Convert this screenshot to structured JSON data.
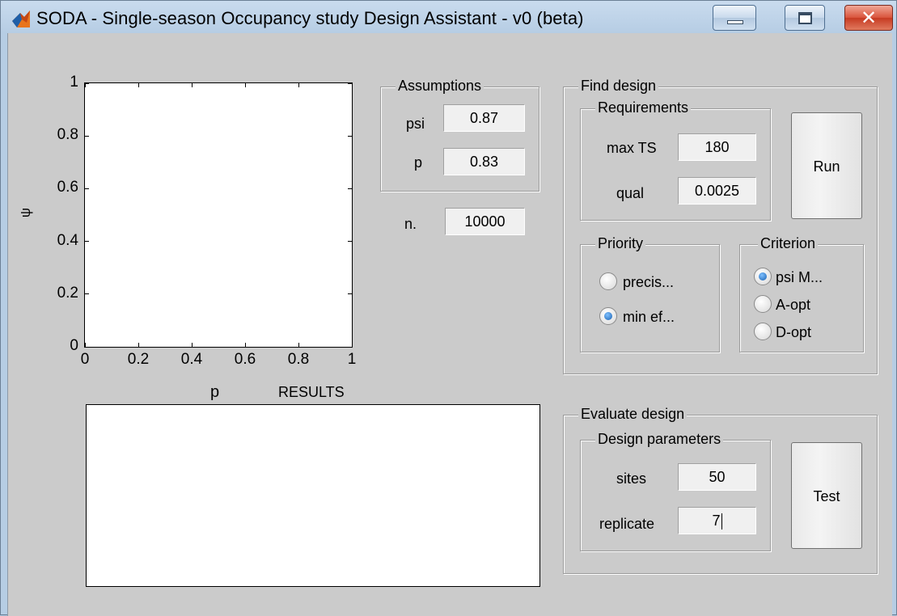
{
  "window": {
    "title": "SODA - Single-season Occupancy study Design Assistant - v0 (beta)",
    "controls": {
      "minimize": "minimize-icon",
      "maximize": "maximize-icon",
      "close": "close-icon"
    }
  },
  "chart_data": {
    "type": "scatter",
    "xlabel": "p",
    "ylabel": "ψ",
    "xlim": [
      0,
      1
    ],
    "ylim": [
      0,
      1
    ],
    "x_ticks": [
      "0",
      "0.2",
      "0.4",
      "0.6",
      "0.8",
      "1"
    ],
    "y_ticks": [
      "0",
      "0.2",
      "0.4",
      "0.6",
      "0.8",
      "1"
    ],
    "series": []
  },
  "results": {
    "label": "RESULTS",
    "text": ""
  },
  "assumptions": {
    "legend": "Assumptions",
    "psi_label": "psi",
    "psi_value": "0.87",
    "p_label": "p",
    "p_value": "0.83"
  },
  "n": {
    "label": "n.",
    "value": "10000"
  },
  "find_design": {
    "legend": "Find design",
    "requirements": {
      "legend": "Requirements",
      "maxts_label": "max TS",
      "maxts_value": "180",
      "qual_label": "qual",
      "qual_value": "0.0025"
    },
    "run_label": "Run",
    "priority": {
      "legend": "Priority",
      "options": [
        {
          "label": "precis...",
          "selected": false
        },
        {
          "label": "min ef...",
          "selected": true
        }
      ]
    },
    "criterion": {
      "legend": "Criterion",
      "options": [
        {
          "label": "psi M...",
          "selected": true
        },
        {
          "label": "A-opt",
          "selected": false
        },
        {
          "label": "D-opt",
          "selected": false
        }
      ]
    }
  },
  "evaluate_design": {
    "legend": "Evaluate design",
    "params": {
      "legend": "Design parameters",
      "sites_label": "sites",
      "sites_value": "50",
      "replicate_label": "replicate",
      "replicate_value": "7"
    },
    "test_label": "Test"
  }
}
